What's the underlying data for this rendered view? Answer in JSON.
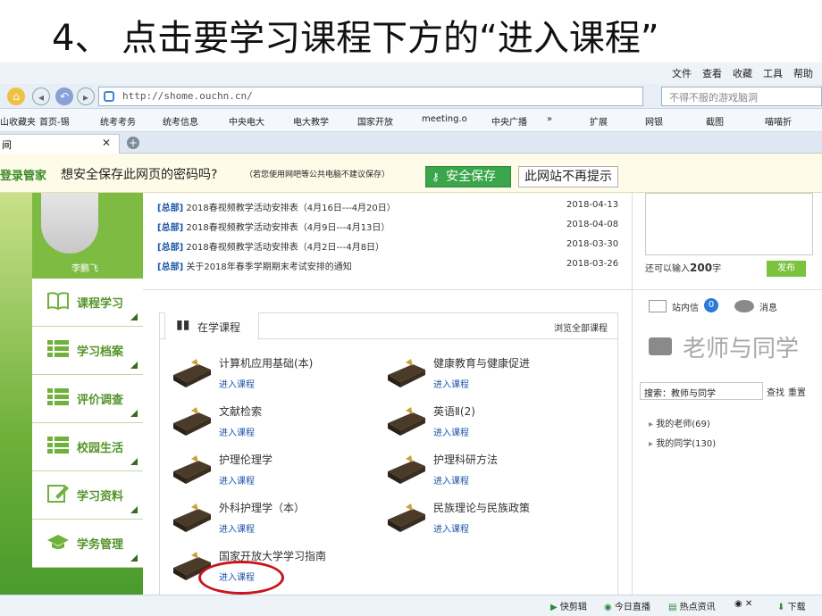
{
  "slide": {
    "title": "4、 点击要学习课程下方的“进入课程”"
  },
  "browser": {
    "menu": [
      "文件",
      "查看",
      "收藏",
      "工具",
      "帮助"
    ],
    "address": "http://shome.ouchn.cn/",
    "search_placeholder": "不得不服的游戏脑洞",
    "favorites": [
      "山收藏夹",
      "首页-锡",
      "统考考务",
      "统考信息",
      "中央电大",
      "电大教学",
      "国家开放",
      "meeting.o",
      "中央广播",
      "»"
    ],
    "toolbar_right": [
      "扩展",
      "网银",
      "截图",
      "喵喵折"
    ],
    "tab_label": "间"
  },
  "password_bar": {
    "brand": "登录管家",
    "question": "想安全保存此网页的密码吗?",
    "note": "（若您使用网吧等公共电脑不建议保存）",
    "save": "安全保存",
    "no_more": "此网站不再提示"
  },
  "profile": {
    "name": "李鹏飞"
  },
  "sidebar": [
    {
      "label": "课程学习",
      "icon": "book-open-icon"
    },
    {
      "label": "学习档案",
      "icon": "list-icon"
    },
    {
      "label": "评价调查",
      "icon": "list-icon"
    },
    {
      "label": "校园生活",
      "icon": "list-icon"
    },
    {
      "label": "学习资料",
      "icon": "edit-icon"
    },
    {
      "label": "学务管理",
      "icon": "graduation-cap-icon"
    }
  ],
  "news": [
    {
      "tag": "[总部]",
      "title": "2018春视频教学活动安排表（4月16日---4月20日）",
      "date": "2018-04-13"
    },
    {
      "tag": "[总部]",
      "title": "2018春视频教学活动安排表（4月9日---4月13日）",
      "date": "2018-04-08"
    },
    {
      "tag": "[总部]",
      "title": "2018春视频教学活动安排表（4月2日---4月8日）",
      "date": "2018-03-30"
    },
    {
      "tag": "[总部]",
      "title": "关于2018年春季学期期末考试安排的通知",
      "date": "2018-03-26"
    }
  ],
  "courses": {
    "tab": "在学课程",
    "browse_all": "浏览全部课程",
    "enter_label": "进入课程",
    "items": [
      {
        "name": "计算机应用基础(本)"
      },
      {
        "name": "健康教育与健康促进"
      },
      {
        "name": "文献检索"
      },
      {
        "name": "英语Ⅱ(2)"
      },
      {
        "name": "护理伦理学"
      },
      {
        "name": "护理科研方法"
      },
      {
        "name": "外科护理学（本）"
      },
      {
        "name": "民族理论与民族政策"
      },
      {
        "name": "国家开放大学学习指南"
      }
    ]
  },
  "right_panel": {
    "hint": "还可以输入",
    "count": "200",
    "unit": "字",
    "publish": "发布",
    "mail_label": "站内信",
    "mail_count": "0",
    "msg_label": "消息",
    "heading": "老师与同学",
    "search_label": "搜索：教师与同学",
    "find": "查找",
    "reset": "重置",
    "teachers": "我的老师(69)",
    "classmates": "我的同学(130)"
  },
  "statusbar": [
    "快剪辑",
    "今日直播",
    "热点资讯",
    "下载"
  ],
  "colors": {
    "accent_green": "#6fb13a",
    "link_blue": "#1a55a8",
    "highlight_red": "#c4161c"
  }
}
